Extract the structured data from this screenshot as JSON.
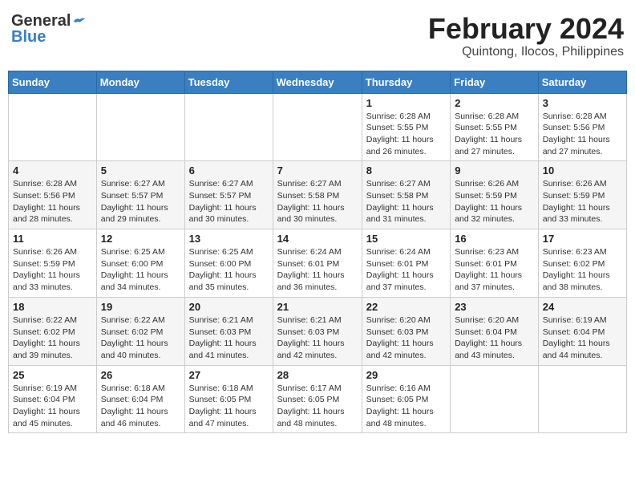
{
  "header": {
    "logo_general": "General",
    "logo_blue": "Blue",
    "month": "February 2024",
    "location": "Quintong, Ilocos, Philippines"
  },
  "weekdays": [
    "Sunday",
    "Monday",
    "Tuesday",
    "Wednesday",
    "Thursday",
    "Friday",
    "Saturday"
  ],
  "weeks": [
    [
      {
        "day": "",
        "info": ""
      },
      {
        "day": "",
        "info": ""
      },
      {
        "day": "",
        "info": ""
      },
      {
        "day": "",
        "info": ""
      },
      {
        "day": "1",
        "info": "Sunrise: 6:28 AM\nSunset: 5:55 PM\nDaylight: 11 hours\nand 26 minutes."
      },
      {
        "day": "2",
        "info": "Sunrise: 6:28 AM\nSunset: 5:55 PM\nDaylight: 11 hours\nand 27 minutes."
      },
      {
        "day": "3",
        "info": "Sunrise: 6:28 AM\nSunset: 5:56 PM\nDaylight: 11 hours\nand 27 minutes."
      }
    ],
    [
      {
        "day": "4",
        "info": "Sunrise: 6:28 AM\nSunset: 5:56 PM\nDaylight: 11 hours\nand 28 minutes."
      },
      {
        "day": "5",
        "info": "Sunrise: 6:27 AM\nSunset: 5:57 PM\nDaylight: 11 hours\nand 29 minutes."
      },
      {
        "day": "6",
        "info": "Sunrise: 6:27 AM\nSunset: 5:57 PM\nDaylight: 11 hours\nand 30 minutes."
      },
      {
        "day": "7",
        "info": "Sunrise: 6:27 AM\nSunset: 5:58 PM\nDaylight: 11 hours\nand 30 minutes."
      },
      {
        "day": "8",
        "info": "Sunrise: 6:27 AM\nSunset: 5:58 PM\nDaylight: 11 hours\nand 31 minutes."
      },
      {
        "day": "9",
        "info": "Sunrise: 6:26 AM\nSunset: 5:59 PM\nDaylight: 11 hours\nand 32 minutes."
      },
      {
        "day": "10",
        "info": "Sunrise: 6:26 AM\nSunset: 5:59 PM\nDaylight: 11 hours\nand 33 minutes."
      }
    ],
    [
      {
        "day": "11",
        "info": "Sunrise: 6:26 AM\nSunset: 5:59 PM\nDaylight: 11 hours\nand 33 minutes."
      },
      {
        "day": "12",
        "info": "Sunrise: 6:25 AM\nSunset: 6:00 PM\nDaylight: 11 hours\nand 34 minutes."
      },
      {
        "day": "13",
        "info": "Sunrise: 6:25 AM\nSunset: 6:00 PM\nDaylight: 11 hours\nand 35 minutes."
      },
      {
        "day": "14",
        "info": "Sunrise: 6:24 AM\nSunset: 6:01 PM\nDaylight: 11 hours\nand 36 minutes."
      },
      {
        "day": "15",
        "info": "Sunrise: 6:24 AM\nSunset: 6:01 PM\nDaylight: 11 hours\nand 37 minutes."
      },
      {
        "day": "16",
        "info": "Sunrise: 6:23 AM\nSunset: 6:01 PM\nDaylight: 11 hours\nand 37 minutes."
      },
      {
        "day": "17",
        "info": "Sunrise: 6:23 AM\nSunset: 6:02 PM\nDaylight: 11 hours\nand 38 minutes."
      }
    ],
    [
      {
        "day": "18",
        "info": "Sunrise: 6:22 AM\nSunset: 6:02 PM\nDaylight: 11 hours\nand 39 minutes."
      },
      {
        "day": "19",
        "info": "Sunrise: 6:22 AM\nSunset: 6:02 PM\nDaylight: 11 hours\nand 40 minutes."
      },
      {
        "day": "20",
        "info": "Sunrise: 6:21 AM\nSunset: 6:03 PM\nDaylight: 11 hours\nand 41 minutes."
      },
      {
        "day": "21",
        "info": "Sunrise: 6:21 AM\nSunset: 6:03 PM\nDaylight: 11 hours\nand 42 minutes."
      },
      {
        "day": "22",
        "info": "Sunrise: 6:20 AM\nSunset: 6:03 PM\nDaylight: 11 hours\nand 42 minutes."
      },
      {
        "day": "23",
        "info": "Sunrise: 6:20 AM\nSunset: 6:04 PM\nDaylight: 11 hours\nand 43 minutes."
      },
      {
        "day": "24",
        "info": "Sunrise: 6:19 AM\nSunset: 6:04 PM\nDaylight: 11 hours\nand 44 minutes."
      }
    ],
    [
      {
        "day": "25",
        "info": "Sunrise: 6:19 AM\nSunset: 6:04 PM\nDaylight: 11 hours\nand 45 minutes."
      },
      {
        "day": "26",
        "info": "Sunrise: 6:18 AM\nSunset: 6:04 PM\nDaylight: 11 hours\nand 46 minutes."
      },
      {
        "day": "27",
        "info": "Sunrise: 6:18 AM\nSunset: 6:05 PM\nDaylight: 11 hours\nand 47 minutes."
      },
      {
        "day": "28",
        "info": "Sunrise: 6:17 AM\nSunset: 6:05 PM\nDaylight: 11 hours\nand 48 minutes."
      },
      {
        "day": "29",
        "info": "Sunrise: 6:16 AM\nSunset: 6:05 PM\nDaylight: 11 hours\nand 48 minutes."
      },
      {
        "day": "",
        "info": ""
      },
      {
        "day": "",
        "info": ""
      }
    ]
  ]
}
